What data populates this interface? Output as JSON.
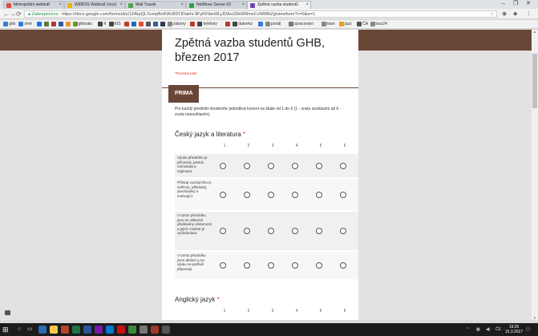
{
  "browser": {
    "tabs": [
      {
        "label": "Metropolitní webinář",
        "fav": "#e04b3c"
      },
      {
        "label": "WEBOS Webinář (více)",
        "fav": "#e7b400"
      },
      {
        "label": "Mail Tracek",
        "fav": "#4ba84b"
      },
      {
        "label": "NetMove Server 02",
        "fav": "#2aa44a"
      },
      {
        "label": "Zpětná vazba studentů",
        "fav": "#7248b9"
      }
    ],
    "address": {
      "secure_label": "Zabezpečeno",
      "url": "https://docs.google.com/forms/d/e/1FAIpQLScmpBxKWcB9YlOakhi-9FyKFtbeWLjJDAxUDkWRmsCvNR8bZg/viewform?c=0&w=1"
    },
    "bookmarks": [
      {
        "label": "ghb",
        "color": "#3a7bd5"
      },
      {
        "label": "sheł",
        "color": "#3a7bd5"
      },
      {
        "label": "",
        "color": "#1a73e8"
      },
      {
        "label": "",
        "color": "#5b7b3a"
      },
      {
        "label": "",
        "color": "#b03a2e"
      },
      {
        "label": "",
        "color": "#2f5ea8"
      },
      {
        "label": "",
        "color": "#e29b2f"
      },
      {
        "label": "ghbvaki",
        "color": "#6f8f3a"
      },
      {
        "label": "K",
        "color": "#444"
      },
      {
        "label": "KIS",
        "color": "#444"
      },
      {
        "label": "",
        "color": "#c0392b"
      },
      {
        "label": "",
        "color": "#1f6fb2"
      },
      {
        "label": "",
        "color": "#e74c3c"
      },
      {
        "label": "",
        "color": "#555"
      },
      {
        "label": "",
        "color": "#3b5998"
      },
      {
        "label": "",
        "color": "#2c3e50"
      },
      {
        "label": "zákony",
        "color": "#888"
      },
      {
        "label": "",
        "color": "#c0392b"
      },
      {
        "label": "telefony",
        "color": "#444"
      },
      {
        "label": "",
        "color": "#c0392b"
      },
      {
        "label": "datovka",
        "color": "#444"
      },
      {
        "label": "",
        "color": "#3a7bd5"
      },
      {
        "label": "portál",
        "color": "#888"
      },
      {
        "label": "zpracování",
        "color": "#777"
      },
      {
        "label": "tram",
        "color": "#888"
      },
      {
        "label": "jazz",
        "color": "#e3a21a"
      },
      {
        "label": "ČA",
        "color": "#555"
      },
      {
        "label": "losz24",
        "color": "#888"
      }
    ]
  },
  "form": {
    "title": "Zpětná vazba studentů GHB, březen 2017",
    "required_note": "*Povinné pole",
    "section": "PRIMA",
    "instructions": "Pro každý předmět ohodnoťte jednotlivá tvrzení na škále od 1 do 6 (1 - zcela souhlasím až 6 - zcela nesouhlasím).",
    "scale": [
      "1",
      "2",
      "3",
      "4",
      "5",
      "6"
    ],
    "questions": [
      {
        "title": "Český jazyk a literatura",
        "required": "*",
        "rows": [
          "Výuka předmětu je přínosná, pestrá, rozmanitá a zajímavá.",
          "Přístup vyučujícího je vstřícný, příkladný, povzbudivý a motivující.",
          "V tomto předmětu jsou mi odborně předávány vědomosti a jejich znalost je vyžadována.",
          "V tomto předmětu jsem aktivní a na výuku se pečlivě připravuji."
        ]
      },
      {
        "title": "Anglický jazyk",
        "required": "*",
        "rows": []
      }
    ]
  },
  "taskbar": {
    "clock_time": "19:25",
    "clock_date": "15.3.2017"
  }
}
